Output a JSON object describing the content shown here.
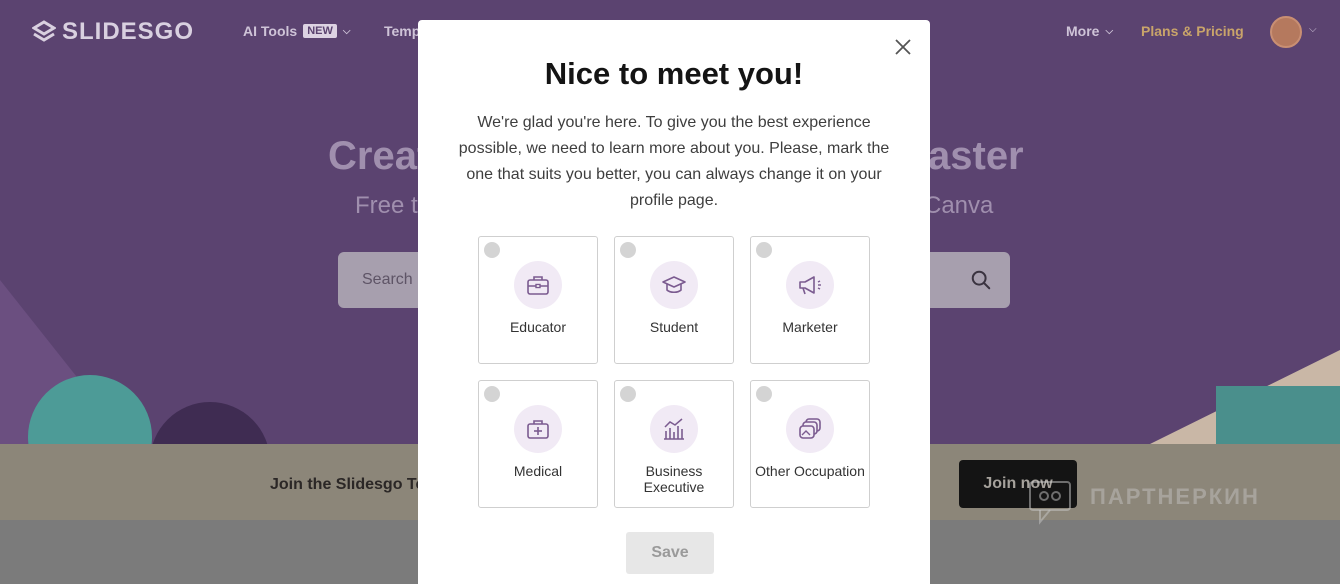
{
  "nav": {
    "logo": "SLIDESGO",
    "ai_tools": "AI Tools",
    "new_badge": "NEW",
    "templates_partial": "Temp",
    "more": "More",
    "pricing": "Plans & Pricing"
  },
  "hero": {
    "title_left": "Creat",
    "title_right": "aster",
    "subtitle_left": "Free t",
    "subtitle_right": "Canva",
    "search_placeholder": "Search"
  },
  "join": {
    "text": "Join the Slidesgo Te",
    "button": "Join now"
  },
  "watermark": "ПАРТНЕРКИН",
  "modal": {
    "title": "Nice to meet you!",
    "description": "We're glad you're here. To give you the best experience possible, we need to learn more about you. Please, mark the one that suits you better, you can always change it on your profile page.",
    "options": [
      {
        "label": "Educator",
        "icon": "briefcase-icon"
      },
      {
        "label": "Student",
        "icon": "graduation-cap-icon"
      },
      {
        "label": "Marketer",
        "icon": "megaphone-icon"
      },
      {
        "label": "Medical",
        "icon": "medical-kit-icon"
      },
      {
        "label": "Business Executive",
        "icon": "chart-icon"
      },
      {
        "label": "Other Occupation",
        "icon": "images-icon"
      }
    ],
    "save": "Save"
  },
  "colors": {
    "hero_bg": "#5b4370",
    "accent_icon_bg": "#f1eaf5",
    "icon_stroke": "#7b5b90",
    "pricing": "#c9a46a"
  }
}
